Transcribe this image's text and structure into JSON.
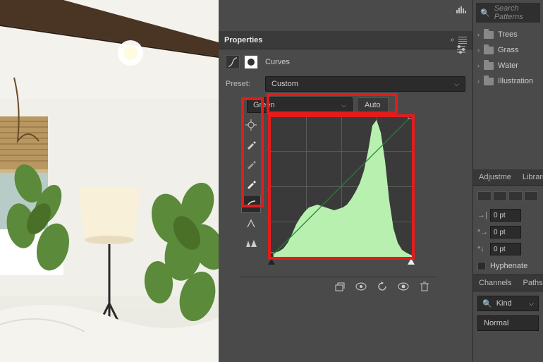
{
  "properties": {
    "title": "Properties",
    "adjustment_label": "Curves",
    "preset_label": "Preset:",
    "preset_value": "Custom",
    "channel_value": "Green",
    "auto_label": "Auto"
  },
  "right_panel": {
    "search_placeholder": "Search Patterns",
    "folders": [
      "Trees",
      "Grass",
      "Water",
      "Illustration"
    ],
    "tabs1": [
      "Adjustme",
      "Libraries"
    ],
    "indent_fields": [
      "0 pt",
      "0 pt",
      "0 pt"
    ],
    "hyphenate": "Hyphenate",
    "tabs2": [
      "Channels",
      "Paths"
    ],
    "kind_label": "Kind",
    "blend_mode": "Normal"
  },
  "chart_data": {
    "type": "curves_histogram",
    "channel": "Green",
    "x_range": [
      0,
      255
    ],
    "y_range": [
      0,
      255
    ],
    "curve_points": [
      [
        0,
        0
      ],
      [
        255,
        255
      ]
    ],
    "histogram_bins_approx": [
      2,
      3,
      4,
      5,
      8,
      12,
      18,
      24,
      28,
      32,
      34,
      35,
      36,
      35,
      34,
      33,
      32,
      33,
      34,
      36,
      40,
      45,
      50,
      58,
      70,
      90,
      130,
      170,
      140,
      80,
      40,
      18,
      10,
      6,
      4,
      2
    ],
    "slider_black_pos": 0,
    "slider_white_pos": 255
  },
  "colors": {
    "highlight": "#e41b1b",
    "hist_fill": "#b8f0b0",
    "curve_line": "#00a020"
  }
}
